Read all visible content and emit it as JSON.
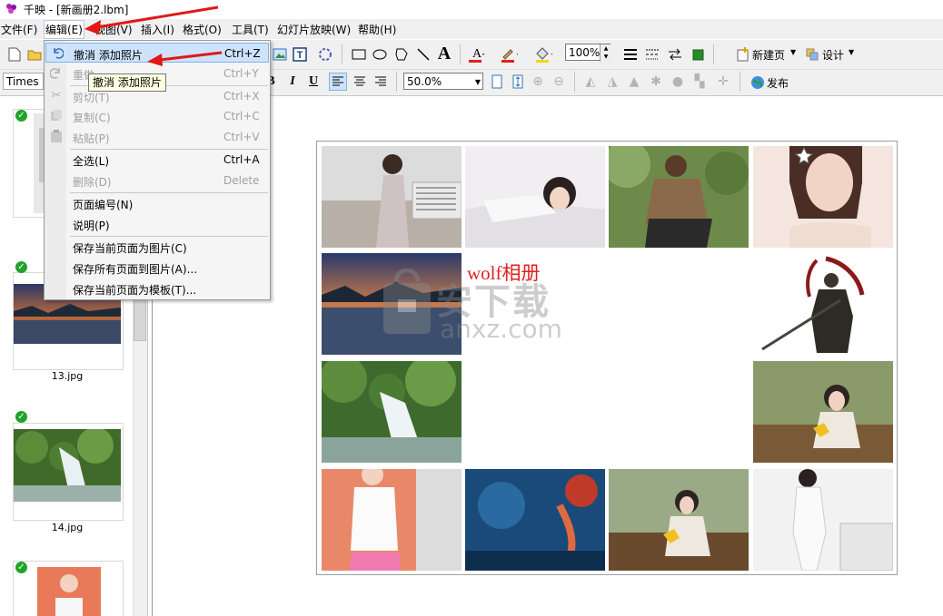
{
  "window": {
    "title": "千映 - [新画册2.lbm]"
  },
  "menubar": {
    "items": [
      "文件(F)",
      "编辑(E)",
      "视图(V)",
      "插入(I)",
      "格式(O)",
      "工具(T)",
      "幻灯片放映(W)",
      "帮助(H)"
    ]
  },
  "toolbar": {
    "zoom": "100%",
    "new_page": "新建页",
    "design": "设计",
    "font": "Times",
    "scale": "50.0%",
    "publish": "发布"
  },
  "edit_menu": {
    "items": [
      {
        "label": "撤消 添加照片",
        "shortcut": "Ctrl+Z",
        "enabled": true,
        "highlighted": true,
        "icon": "undo-icon"
      },
      {
        "label": "重做",
        "shortcut": "Ctrl+Y",
        "enabled": false,
        "icon": "redo-icon"
      },
      {
        "label": "剪切(T)",
        "shortcut": "Ctrl+X",
        "enabled": false,
        "icon": "scissors-icon"
      },
      {
        "label": "复制(C)",
        "shortcut": "Ctrl+C",
        "enabled": false,
        "icon": "copy-icon"
      },
      {
        "label": "粘贴(P)",
        "shortcut": "Ctrl+V",
        "enabled": false,
        "icon": "paste-icon"
      },
      {
        "label": "全选(L)",
        "shortcut": "Ctrl+A",
        "enabled": true
      },
      {
        "label": "删除(D)",
        "shortcut": "Delete",
        "enabled": false
      },
      {
        "label": "页面编号(N)",
        "shortcut": "",
        "enabled": true
      },
      {
        "label": "说明(P)",
        "shortcut": "",
        "enabled": true
      },
      {
        "label": "保存当前页面为图片(C)",
        "shortcut": "",
        "enabled": true
      },
      {
        "label": "保存所有页面到图片(A)...",
        "shortcut": "",
        "enabled": true
      },
      {
        "label": "保存当前页面为模板(T)...",
        "shortcut": "",
        "enabled": true
      }
    ],
    "tooltip": "撤消 添加照片"
  },
  "thumbnails": [
    {
      "caption": "13.jpg"
    },
    {
      "caption": "14.jpg"
    }
  ],
  "page": {
    "album_title": "wolf相册",
    "watermark_main": "安下载",
    "watermark_sub": "anxz.com"
  },
  "colors": {
    "accent_red": "#e02020",
    "menu_highlight": "#cde3fb",
    "check_green": "#1fa32a"
  }
}
